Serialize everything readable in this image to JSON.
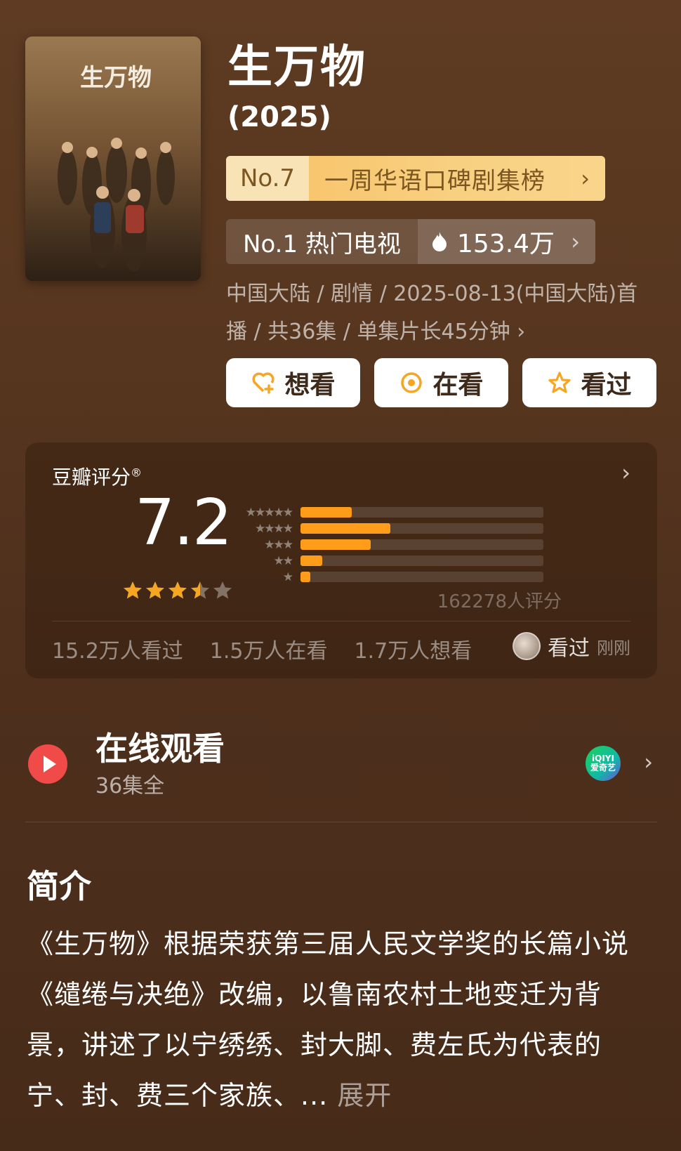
{
  "title": "生万物",
  "year": "(2025)",
  "poster": {
    "logo_text": "生万物"
  },
  "rank_badge": {
    "number": "No.7",
    "text": "一周华语口碑剧集榜",
    "chevron": "›"
  },
  "hot_badge": {
    "text": "No.1 热门电视",
    "count": "153.4万",
    "chevron": "›",
    "icon": "flame-icon"
  },
  "meta": {
    "text": "中国大陆 / 剧情 / 2025-08-13(中国大陆)首播 / 共36集 / 单集片长45分钟",
    "chevron": "›"
  },
  "actions": {
    "want": "想看",
    "watching": "在看",
    "watched": "看过"
  },
  "rating": {
    "label": "豆瓣评分",
    "trademark": "®",
    "score": "7.2",
    "stars_value": 3.5,
    "distribution": [
      {
        "stars": "★★★★★",
        "fraction": 0.21
      },
      {
        "stars": "★★★★",
        "fraction": 0.37
      },
      {
        "stars": "★★★",
        "fraction": 0.29
      },
      {
        "stars": "★★",
        "fraction": 0.09
      },
      {
        "stars": "★",
        "fraction": 0.04
      }
    ],
    "count": "162278人评分",
    "stats": [
      "15.2万人看过",
      "1.5万人在看",
      "1.7万人想看"
    ],
    "friend_status": "看过",
    "friend_time": "刚刚",
    "chevron": "›"
  },
  "watch": {
    "title": "在线观看",
    "subtitle": "36集全",
    "platform_line1": "iQIYI",
    "platform_line2": "爱奇艺",
    "chevron": "›"
  },
  "intro": {
    "title": "简介",
    "text": "《生万物》根据荣获第三届人民文学奖的长篇小说《缱绻与决绝》改编，以鲁南农村土地变迁为背景，讲述了以宁绣绣、封大脚、费左氏为代表的宁、封、费三个家族、...",
    "more": "展开"
  },
  "colors": {
    "accent_orange": "#ff9c1a",
    "star_orange": "#f5a623",
    "play_red": "#f04b48"
  }
}
